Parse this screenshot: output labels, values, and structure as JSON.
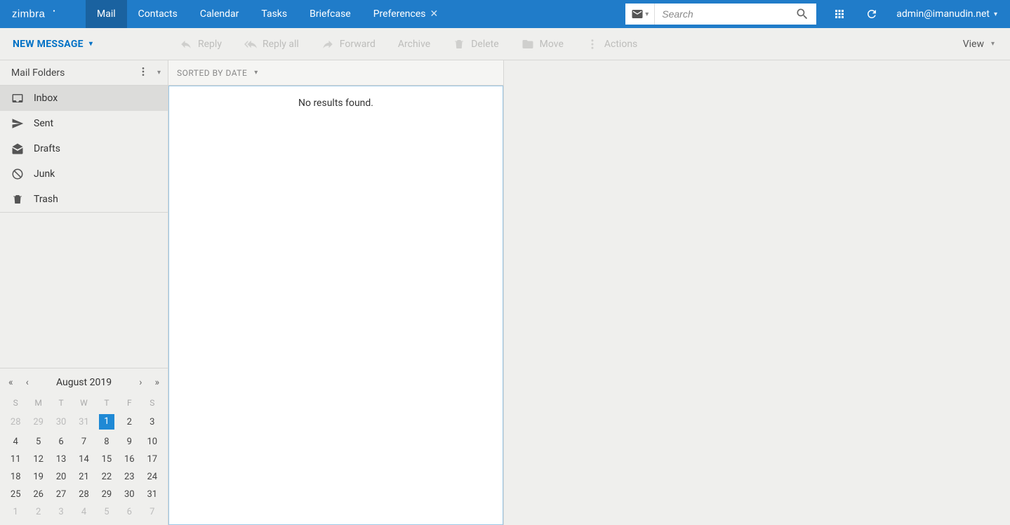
{
  "app": {
    "logo_text": "zimbra"
  },
  "header": {
    "tabs": [
      {
        "label": "Mail",
        "active": true
      },
      {
        "label": "Contacts"
      },
      {
        "label": "Calendar"
      },
      {
        "label": "Tasks"
      },
      {
        "label": "Briefcase"
      },
      {
        "label": "Preferences",
        "closable": true
      }
    ],
    "search_placeholder": "Search",
    "user": "admin@imanudin.net"
  },
  "toolbar": {
    "compose": "NEW MESSAGE",
    "reply": "Reply",
    "reply_all": "Reply all",
    "forward": "Forward",
    "archive": "Archive",
    "delete": "Delete",
    "move": "Move",
    "actions": "Actions",
    "view": "View"
  },
  "sidebar": {
    "title": "Mail Folders",
    "folders": [
      {
        "key": "inbox",
        "label": "Inbox",
        "active": true
      },
      {
        "key": "sent",
        "label": "Sent"
      },
      {
        "key": "drafts",
        "label": "Drafts"
      },
      {
        "key": "junk",
        "label": "Junk"
      },
      {
        "key": "trash",
        "label": "Trash"
      }
    ]
  },
  "calendar": {
    "title": "August 2019",
    "dow": [
      "S",
      "M",
      "T",
      "W",
      "T",
      "F",
      "S"
    ],
    "weeks": [
      [
        {
          "d": "28",
          "dim": true
        },
        {
          "d": "29",
          "dim": true
        },
        {
          "d": "30",
          "dim": true
        },
        {
          "d": "31",
          "dim": true
        },
        {
          "d": "1",
          "today": true
        },
        {
          "d": "2"
        },
        {
          "d": "3"
        }
      ],
      [
        {
          "d": "4"
        },
        {
          "d": "5"
        },
        {
          "d": "6"
        },
        {
          "d": "7"
        },
        {
          "d": "8"
        },
        {
          "d": "9"
        },
        {
          "d": "10"
        }
      ],
      [
        {
          "d": "11"
        },
        {
          "d": "12"
        },
        {
          "d": "13"
        },
        {
          "d": "14"
        },
        {
          "d": "15"
        },
        {
          "d": "16"
        },
        {
          "d": "17"
        }
      ],
      [
        {
          "d": "18"
        },
        {
          "d": "19"
        },
        {
          "d": "20"
        },
        {
          "d": "21"
        },
        {
          "d": "22"
        },
        {
          "d": "23"
        },
        {
          "d": "24"
        }
      ],
      [
        {
          "d": "25"
        },
        {
          "d": "26"
        },
        {
          "d": "27"
        },
        {
          "d": "28"
        },
        {
          "d": "29"
        },
        {
          "d": "30"
        },
        {
          "d": "31"
        }
      ],
      [
        {
          "d": "1",
          "dim": true
        },
        {
          "d": "2",
          "dim": true
        },
        {
          "d": "3",
          "dim": true
        },
        {
          "d": "4",
          "dim": true
        },
        {
          "d": "5",
          "dim": true
        },
        {
          "d": "6",
          "dim": true
        },
        {
          "d": "7",
          "dim": true
        }
      ]
    ]
  },
  "list": {
    "sort_label": "SORTED BY DATE",
    "empty": "No results found."
  }
}
